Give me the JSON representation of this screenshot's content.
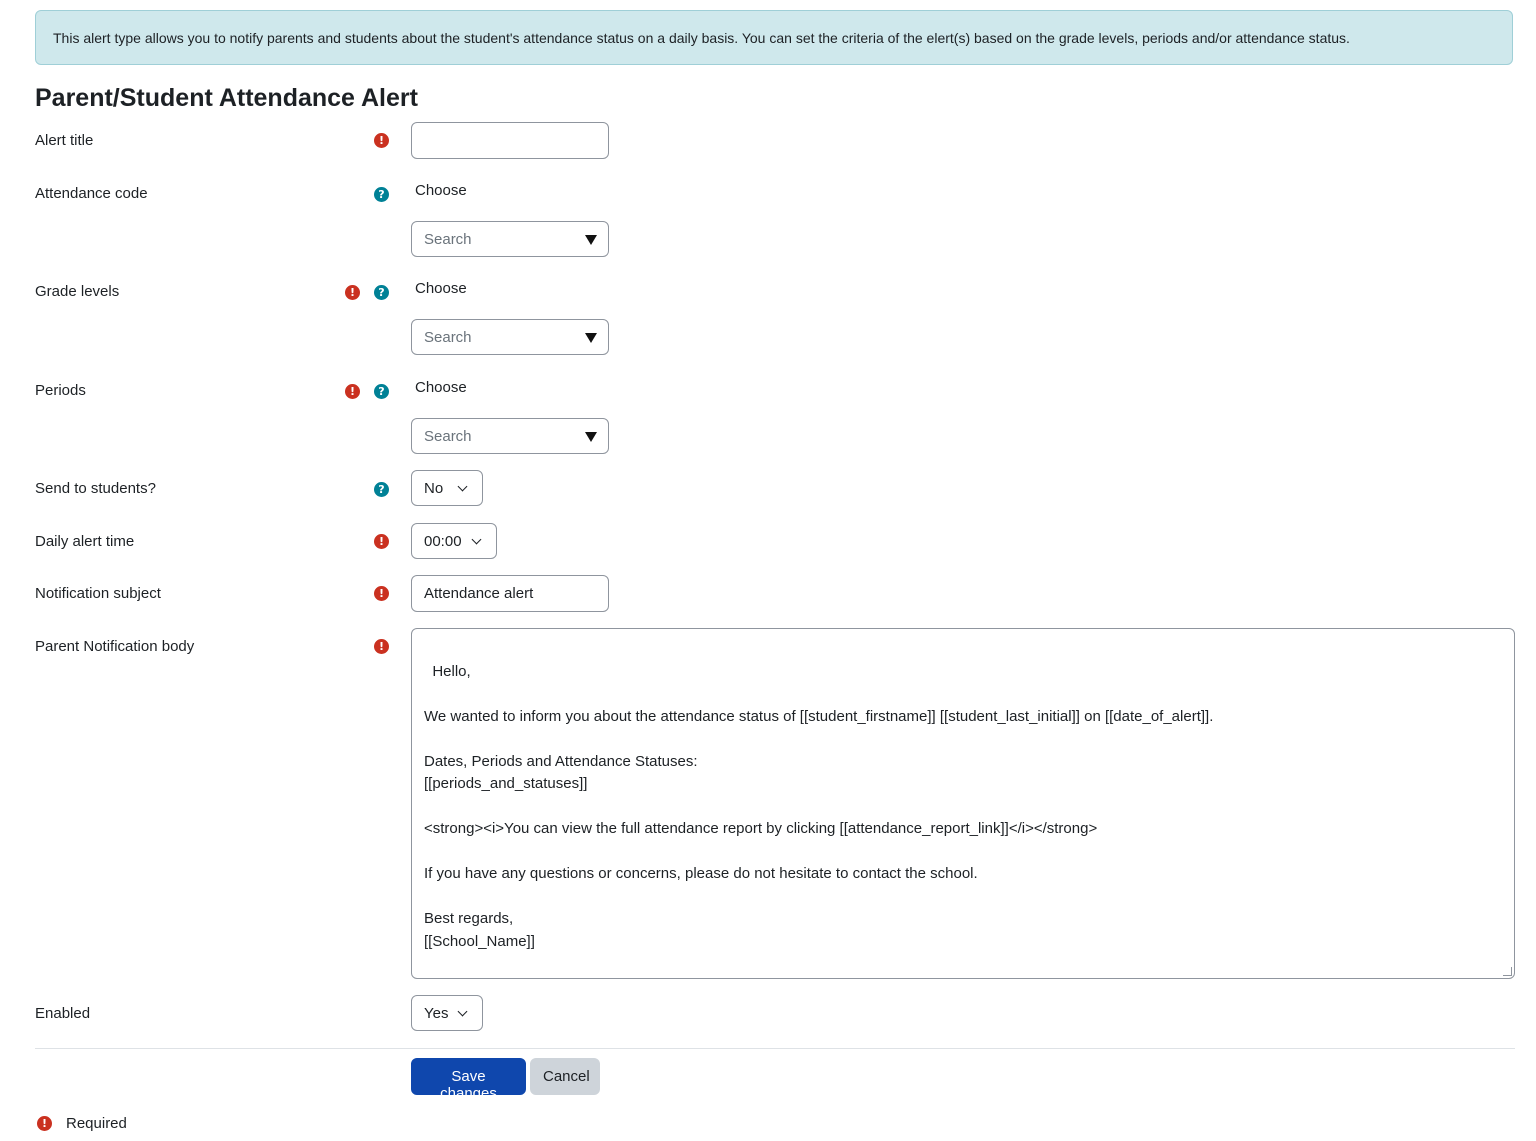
{
  "info_banner": "This alert type allows you to notify parents and students about the student's attendance status on a daily basis. You can set the criteria of the elert(s) based on the grade levels, periods and/or attendance status.",
  "page_title": "Parent/Student Attendance Alert",
  "fields": {
    "alert_title": {
      "label": "Alert title",
      "value": ""
    },
    "attendance_code": {
      "label": "Attendance code",
      "choose": "Choose",
      "search_placeholder": "Search"
    },
    "grade_levels": {
      "label": "Grade levels",
      "choose": "Choose",
      "search_placeholder": "Search"
    },
    "periods": {
      "label": "Periods",
      "choose": "Choose",
      "search_placeholder": "Search"
    },
    "send_to_students": {
      "label": "Send to students?",
      "value": "No"
    },
    "daily_alert_time": {
      "label": "Daily alert time",
      "value": "00:00"
    },
    "notification_subject": {
      "label": "Notification subject",
      "value": "Attendance alert"
    },
    "parent_notification_body": {
      "label": "Parent Notification body",
      "value": "Hello,\n\nWe wanted to inform you about the attendance status of [[student_firstname]] [[student_last_initial]] on [[date_of_alert]].\n\nDates, Periods and Attendance Statuses:\n[[periods_and_statuses]]\n\n<strong><i>You can view the full attendance report by clicking [[attendance_report_link]]</i></strong>\n\nIf you have any questions or concerns, please do not hesitate to contact the school.\n\nBest regards,\n[[School_Name]]"
    },
    "enabled": {
      "label": "Enabled",
      "value": "Yes"
    }
  },
  "buttons": {
    "save": "Save changes",
    "cancel": "Cancel"
  },
  "required_legend": "Required",
  "icons": {
    "required": "exclamation-circle-icon",
    "help": "question-circle-icon"
  },
  "colors": {
    "required": "#ca3120",
    "help": "#008196",
    "primary": "#0f47ad",
    "info_bg": "#cfe8ec"
  }
}
